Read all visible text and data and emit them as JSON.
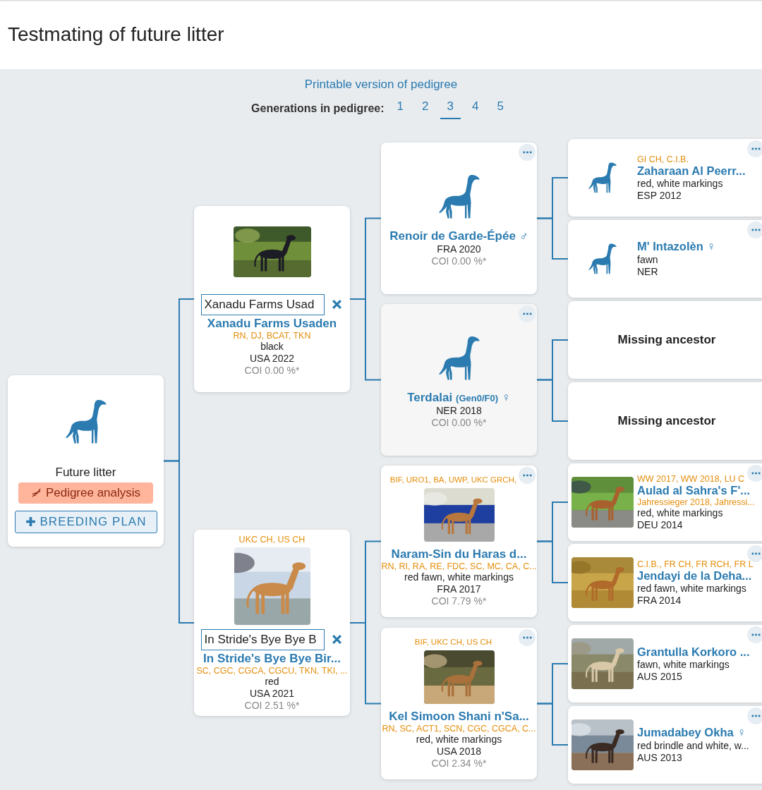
{
  "page_title": "Testmating of future litter",
  "printable_link": "Printable version of pedigree",
  "generations": {
    "label": "Generations in pedigree:",
    "options": [
      {
        "label": "1",
        "selected": false
      },
      {
        "label": "2",
        "selected": false
      },
      {
        "label": "3",
        "selected": true
      },
      {
        "label": "4",
        "selected": false
      },
      {
        "label": "5",
        "selected": false
      }
    ]
  },
  "pedigree": {
    "litter": {
      "kind": "litter",
      "label": "Future litter",
      "actions": [
        {
          "kind": "analysis",
          "label": "Pedigree analysis"
        },
        {
          "kind": "plan",
          "label": "BREEDING PLAN"
        }
      ],
      "parents": [
        {
          "kind": "dog",
          "search": {
            "value": "Xanadu Farms Usad"
          },
          "name": "Xanadu Farms Usaden",
          "titles_after": "RN, DJ, BCAT, TKN",
          "coat": "black",
          "origin": "USA 2022",
          "coi": "COI 0.00 %*",
          "parents": [
            {
              "kind": "dog",
              "menu": true,
              "name": "Renoir de Garde-Épée",
              "sex_symbol": "♂",
              "origin": "FRA 2020",
              "coi": "COI 0.00 %*",
              "parents": [
                {
                  "kind": "dog",
                  "menu": true,
                  "titles": "GI CH, C.I.B.",
                  "name": "Zaharaan Al Peerr...",
                  "coat": "red, white markings",
                  "origin": "ESP 2012"
                },
                {
                  "kind": "dog",
                  "menu": true,
                  "name": "M' Intazolèn",
                  "sex_symbol": "♀",
                  "coat": "fawn",
                  "origin": "NER"
                }
              ]
            },
            {
              "kind": "dog",
              "menu": true,
              "shaded": true,
              "name": "Terdalai",
              "suffix": "(Gen0/F0)",
              "sex_symbol": "♀",
              "origin": "NER 2018",
              "coi": "COI 0.00 %*",
              "parents": [
                {
                  "kind": "missing",
                  "label": "Missing ancestor"
                },
                {
                  "kind": "missing",
                  "label": "Missing ancestor"
                }
              ]
            }
          ]
        },
        {
          "kind": "dog",
          "titles": "UKC CH, US CH",
          "search": {
            "value": "In Stride's Bye Bye B"
          },
          "name": "In Stride's Bye Bye Bir...",
          "titles_after": "SC, CGC, CGCA, CGCU, TKN, TKI, ...",
          "coat": "red",
          "origin": "USA 2021",
          "coi": "COI 2.51 %*",
          "parents": [
            {
              "kind": "dog",
              "menu": true,
              "titles": "BIF, URO1, BA, UWP, UKC GRCH,",
              "name": "Naram-Sin du Haras d...",
              "titles_after": "RN, RI, RA, RE, FDC, SC, MC, CA, C...",
              "coat": "red fawn, white markings",
              "origin": "FRA 2017",
              "coi": "COI 7.79 %*",
              "parents": [
                {
                  "kind": "dog",
                  "menu": true,
                  "titles": "WW 2017, WW 2018, LU C",
                  "name": "Aulad al Sahra's F'...",
                  "titles_after": "Jahressieger 2018, Jahressi...",
                  "coat": "red, white markings",
                  "origin": "DEU 2014"
                },
                {
                  "kind": "dog",
                  "menu": true,
                  "titles": "C.I.B., FR CH, FR RCH, FR L",
                  "name": "Jendayi de la Deha...",
                  "coat": "red fawn, white markings",
                  "origin": "FRA 2014"
                }
              ]
            },
            {
              "kind": "dog",
              "menu": true,
              "titles": "BIF, UKC CH, US CH",
              "name": "Kel Simoon Shani n'Sa...",
              "titles_after": "RN, SC, ACT1, SCN, CGC, CGCA, C...",
              "coat": "red, white markings",
              "origin": "USA 2018",
              "coi": "COI 2.34 %*",
              "parents": [
                {
                  "kind": "dog",
                  "menu": true,
                  "name": "Grantulla Korkoro ...",
                  "coat": "fawn, white markings",
                  "origin": "AUS 2015"
                },
                {
                  "kind": "dog",
                  "menu": true,
                  "name": "Jumadabey Okha",
                  "sex_symbol": "♀",
                  "coat": "red brindle and white, w...",
                  "origin": "AUS 2013"
                }
              ]
            }
          ]
        }
      ]
    }
  }
}
